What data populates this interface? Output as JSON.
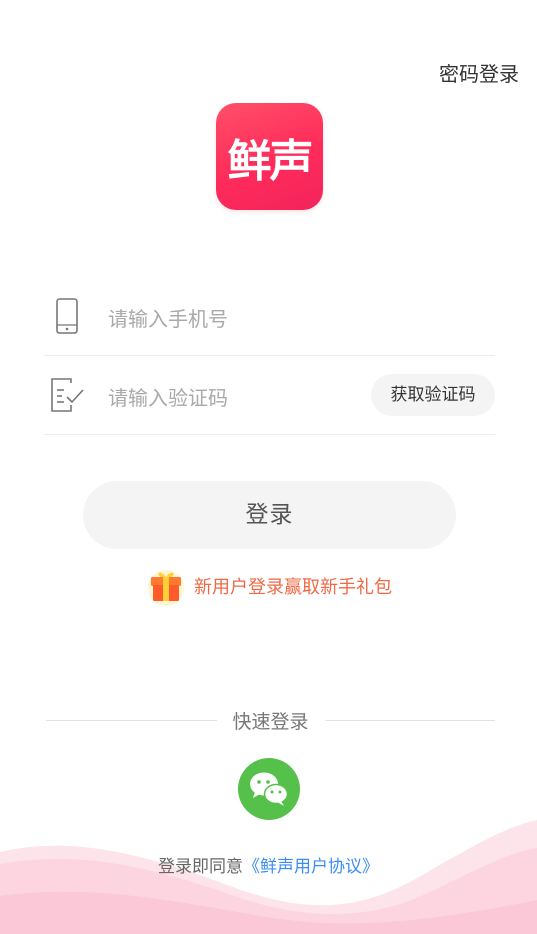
{
  "header": {
    "password_login": "密码登录"
  },
  "logo": {
    "text": "鲜声"
  },
  "form": {
    "phone_placeholder": "请输入手机号",
    "code_placeholder": "请输入验证码",
    "get_code_label": "获取验证码",
    "login_label": "登录"
  },
  "promo": {
    "text": "新用户登录赢取新手礼包",
    "icon": "gift-icon"
  },
  "quick_login": {
    "label": "快速登录",
    "icon": "wechat-icon"
  },
  "footer": {
    "agree_prefix": "登录即同意",
    "agreement_link": "《鲜声用户协议》"
  },
  "colors": {
    "brand": "#ff2b5a",
    "promo_text": "#ee6a45",
    "link": "#3b8df5",
    "wechat": "#56c14a"
  }
}
